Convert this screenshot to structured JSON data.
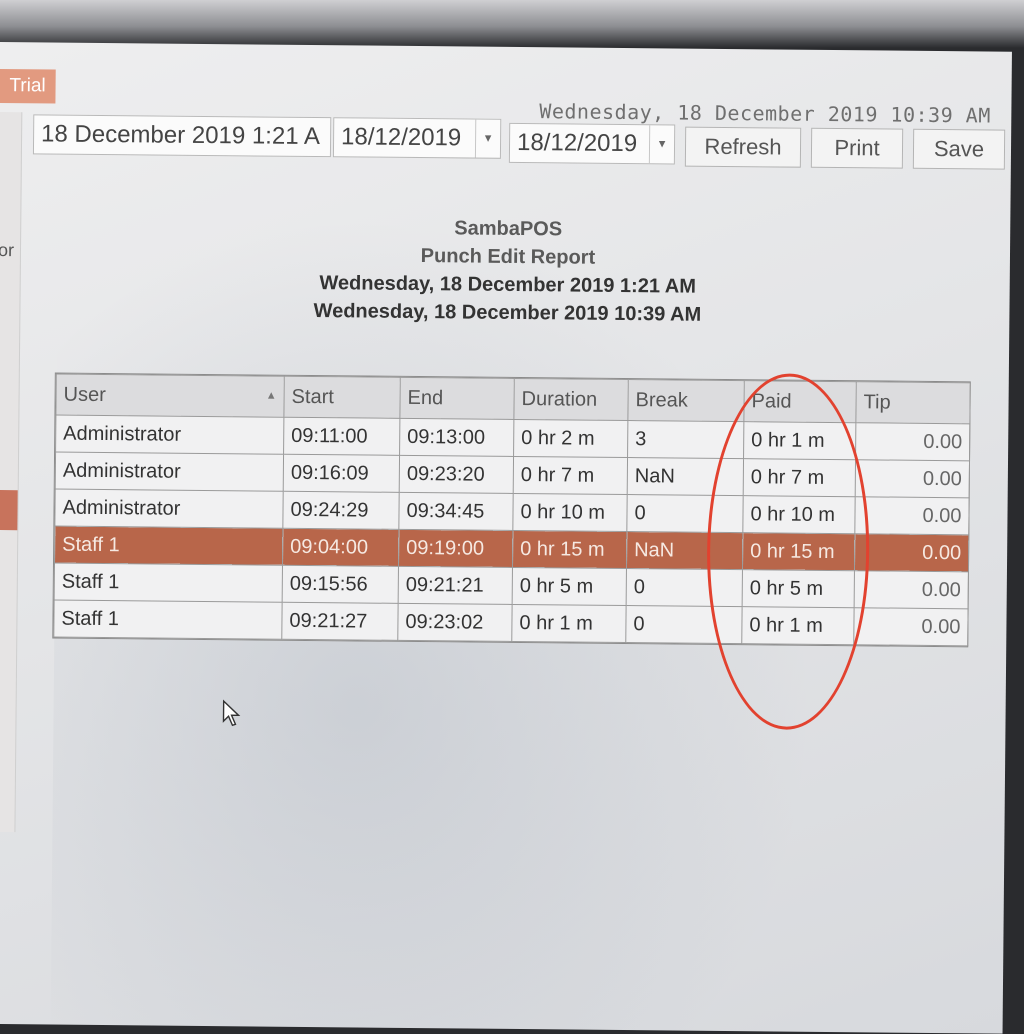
{
  "trial_badge": "Trial",
  "left_fragment": "or",
  "clock": "Wednesday, 18 December 2019 10:39 AM",
  "toolbar": {
    "start_datetime": "18 December 2019 1:21 A",
    "from_date": "18/12/2019",
    "to_date": "18/12/2019",
    "refresh_label": "Refresh",
    "print_label": "Print",
    "save_label": "Save"
  },
  "report": {
    "app_name": "SambaPOS",
    "title": "Punch Edit Report",
    "start": "Wednesday, 18 December 2019 1:21 AM",
    "end": "Wednesday, 18 December 2019 10:39 AM"
  },
  "grid": {
    "columns": [
      "User",
      "Start",
      "End",
      "Duration",
      "Break",
      "Paid",
      "Tip"
    ],
    "sorted_column": "User",
    "selected_row": 3,
    "rows": [
      [
        "Administrator",
        "09:11:00",
        "09:13:00",
        "0 hr 2 m",
        "3",
        "0 hr 1 m",
        "0.00"
      ],
      [
        "Administrator",
        "09:16:09",
        "09:23:20",
        "0 hr 7 m",
        "NaN",
        "0 hr 7 m",
        "0.00"
      ],
      [
        "Administrator",
        "09:24:29",
        "09:34:45",
        "0 hr 10 m",
        "0",
        "0 hr 10 m",
        "0.00"
      ],
      [
        "Staff 1",
        "09:04:00",
        "09:19:00",
        "0 hr 15 m",
        "NaN",
        "0 hr 15 m",
        "0.00"
      ],
      [
        "Staff 1",
        "09:15:56",
        "09:21:21",
        "0 hr 5 m",
        "0",
        "0 hr 5 m",
        "0.00"
      ],
      [
        "Staff 1",
        "09:21:27",
        "09:23:02",
        "0 hr 1 m",
        "0",
        "0 hr 1 m",
        "0.00"
      ]
    ]
  },
  "colors": {
    "selected_row": "#b8664a",
    "annotation": "#e2422f",
    "trial_badge": "#e29a80"
  },
  "icons": {
    "sort": "sort-ascending-icon",
    "dropdown": "chevron-down-icon",
    "cursor": "mouse-pointer-icon"
  }
}
